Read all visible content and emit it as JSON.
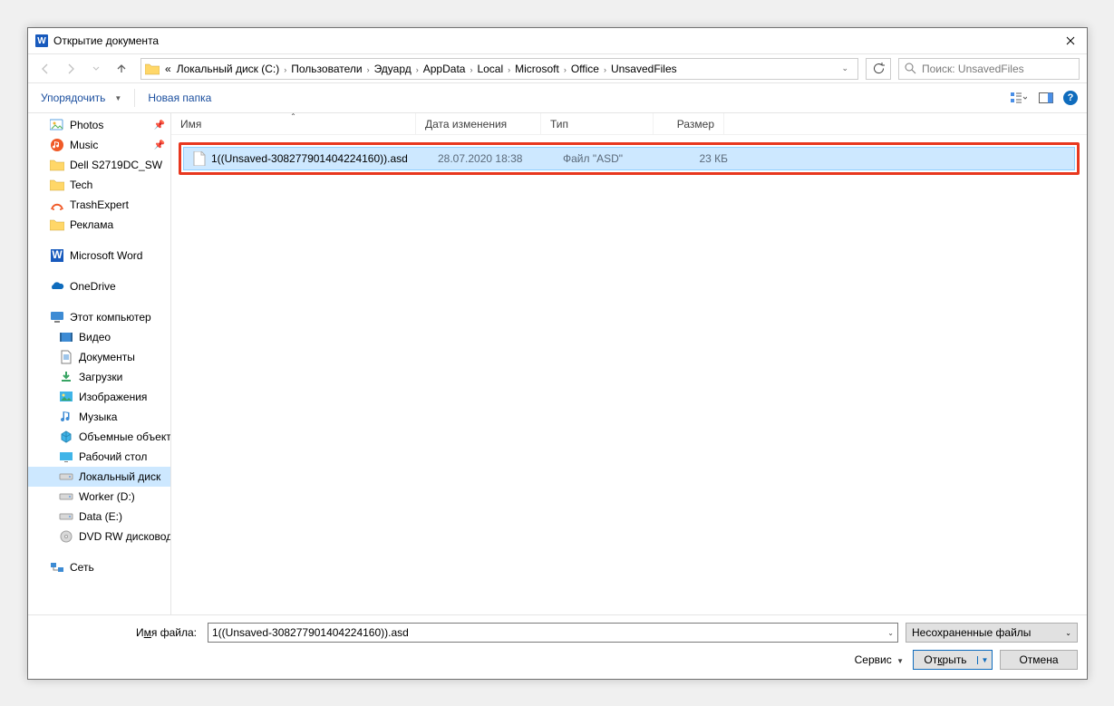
{
  "title": "Открытие документа",
  "breadcrumbs": [
    "Локальный диск (C:)",
    "Пользователи",
    "Эдуард",
    "AppData",
    "Local",
    "Microsoft",
    "Office",
    "UnsavedFiles"
  ],
  "search_placeholder": "Поиск: UnsavedFiles",
  "toolbar": {
    "organize": "Упорядочить",
    "new_folder": "Новая папка"
  },
  "sidebar": [
    {
      "label": "Photos",
      "icon": "photos",
      "pin": true
    },
    {
      "label": "Music",
      "icon": "music",
      "pin": true
    },
    {
      "label": "Dell S2719DC_SW",
      "icon": "folder"
    },
    {
      "label": "Tech",
      "icon": "folder"
    },
    {
      "label": "TrashExpert",
      "icon": "trashexpert"
    },
    {
      "label": "Реклама",
      "icon": "folder"
    },
    {
      "space": true
    },
    {
      "label": "Microsoft Word",
      "icon": "word"
    },
    {
      "space": true
    },
    {
      "label": "OneDrive",
      "icon": "onedrive"
    },
    {
      "space": true
    },
    {
      "label": "Этот компьютер",
      "icon": "pc"
    },
    {
      "label": "Видео",
      "icon": "video",
      "sub": true
    },
    {
      "label": "Документы",
      "icon": "docs",
      "sub": true
    },
    {
      "label": "Загрузки",
      "icon": "dl",
      "sub": true
    },
    {
      "label": "Изображения",
      "icon": "img",
      "sub": true
    },
    {
      "label": "Музыка",
      "icon": "mus",
      "sub": true
    },
    {
      "label": "Объемные объекты",
      "icon": "3d",
      "sub": true
    },
    {
      "label": "Рабочий стол",
      "icon": "desk",
      "sub": true
    },
    {
      "label": "Локальный диск",
      "icon": "drive",
      "sub": true,
      "selected": true
    },
    {
      "label": "Worker (D:)",
      "icon": "drive",
      "sub": true
    },
    {
      "label": "Data (E:)",
      "icon": "drive",
      "sub": true
    },
    {
      "label": "DVD RW дисковод",
      "icon": "dvd",
      "sub": true
    },
    {
      "space": true
    },
    {
      "label": "Сеть",
      "icon": "net"
    }
  ],
  "columns": {
    "name": "Имя",
    "date": "Дата изменения",
    "type": "Тип",
    "size": "Размер"
  },
  "row": {
    "name": "1((Unsaved-308277901404224160)).asd",
    "date": "28.07.2020 18:38",
    "type": "Файл \"ASD\"",
    "size": "23 КБ"
  },
  "footer": {
    "filename_label_pre": "И",
    "filename_label_u": "м",
    "filename_label_post": "я файла:",
    "filename_value": "1((Unsaved-308277901404224160)).asd",
    "filter": "Несохраненные файлы",
    "tools": "Сервис",
    "open_pre": "От",
    "open_u": "к",
    "open_post": "рыть",
    "cancel": "Отмена"
  }
}
